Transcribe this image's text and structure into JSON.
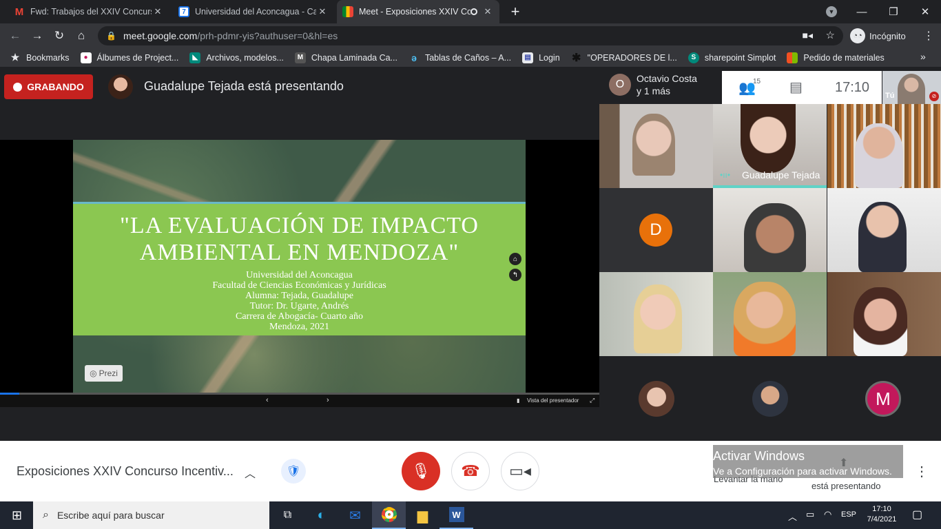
{
  "tabs": [
    {
      "title": "Fwd: Trabajos del XXIV Concurso",
      "icon": "gmail-icon"
    },
    {
      "title": "Universidad del Aconcagua - Cal",
      "icon": "calendar-icon"
    },
    {
      "title": "Meet - Exposiciones XXIV Co",
      "icon": "meet-icon"
    }
  ],
  "address": {
    "host": "meet.google.com",
    "path": "/prh-pdmr-yis?authuser=0&hl=es"
  },
  "incognito_label": "Incógnito",
  "bookmarks": [
    {
      "label": "Bookmarks",
      "color": "#e8eaed",
      "glyph": "★"
    },
    {
      "label": "Álbumes de Project...",
      "color": "#c2185b",
      "glyph": "●"
    },
    {
      "label": "Archivos, modelos...",
      "color": "#00897b",
      "glyph": "◣"
    },
    {
      "label": "Chapa Laminada Ca...",
      "color": "#555555",
      "glyph": "M"
    },
    {
      "label": "Tablas de Caños – A...",
      "color": "#1e88e5",
      "glyph": "ə"
    },
    {
      "label": "Login",
      "color": "#3949ab",
      "glyph": "▤"
    },
    {
      "label": "\"OPERADORES DE l...",
      "color": "#111111",
      "glyph": "✱"
    },
    {
      "label": "sharepoint Simplot",
      "color": "#00897b",
      "glyph": "S"
    },
    {
      "label": "Pedido de materiales",
      "color": "#f4511e",
      "glyph": "■"
    }
  ],
  "meet": {
    "recording_label": "GRABANDO",
    "presenting_text": "Guadalupe Tejada está presentando",
    "others_initial": "O",
    "others_name": "Octavio Costa",
    "others_more": "y 1 más",
    "participant_count": "15",
    "clock": "17:10",
    "self_label": "Tú",
    "speaker_name": "Guadalupe Tejada",
    "tile_d_initial": "D",
    "tile_m_initial": "M",
    "meeting_title": "Exposiciones XXIV Concurso Incentiv...",
    "raise_hand_label": "Levantar la mano",
    "presenting_label": "está presentando",
    "presenter_view_label": "Vista del presentador"
  },
  "slide": {
    "title_line1": "\"LA EVALUACIÓN DE IMPACTO",
    "title_line2": "AMBIENTAL EN MENDOZA\"",
    "lines": [
      "Universidad del Aconcagua",
      "Facultad de Ciencias Económicas y Jurídicas",
      "Alumna: Tejada, Guadalupe",
      "Tutor: Dr. Ugarte, Andrés",
      "Carrera de Abogacía- Cuarto año",
      "Mendoza, 2021"
    ],
    "prezi_label": "Prezi"
  },
  "activate_windows": {
    "title": "Activar Windows",
    "subtitle": "Ve a Configuración para activar Windows."
  },
  "taskbar": {
    "search_placeholder": "Escribe aquí para buscar",
    "lang": "ESP",
    "time": "17:10",
    "date": "7/4/2021"
  }
}
